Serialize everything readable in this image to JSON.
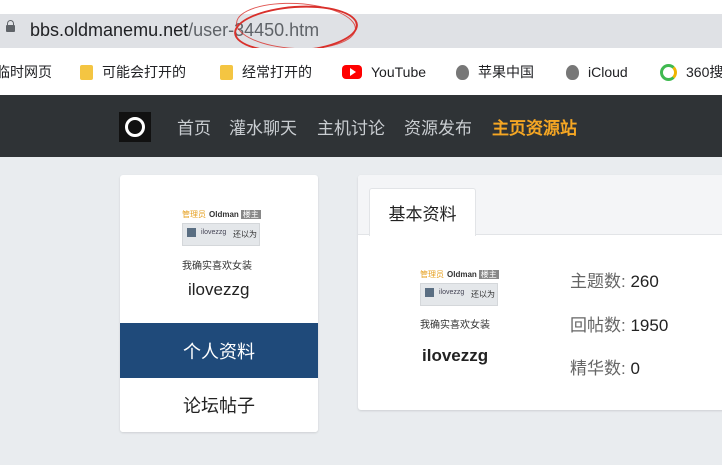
{
  "browser": {
    "url_host": "bbs.oldmanemu.net",
    "url_path": "/user-34450.htm"
  },
  "bookmarks": [
    {
      "label": "临时网页",
      "icon": "page-icon"
    },
    {
      "label": "可能会打开的",
      "icon": "folder-icon"
    },
    {
      "label": "经常打开的",
      "icon": "folder-icon"
    },
    {
      "label": "YouTube",
      "icon": "youtube-icon"
    },
    {
      "label": "苹果中国",
      "icon": "apple-icon"
    },
    {
      "label": "iCloud",
      "icon": "apple-icon"
    },
    {
      "label": "360搜",
      "icon": "360-icon"
    }
  ],
  "nav": {
    "items": [
      "首页",
      "灌水聊天",
      "主机讨论",
      "资源发布",
      "主页资源站"
    ],
    "active_index": 4
  },
  "profile": {
    "badge_role": "管理员",
    "badge_name": "Oldman",
    "badge_tag": "楼主",
    "badge_user": "ilovezzg",
    "badge_extra": "还以为",
    "motto": "我确实喜欢女装",
    "username": "ilovezzg"
  },
  "side_menu": {
    "active": "个人资料",
    "other": "论坛帖子"
  },
  "panel": {
    "tab": "基本资料",
    "stats": [
      {
        "label": "主题数:",
        "value": "260"
      },
      {
        "label": "回帖数:",
        "value": "1950"
      },
      {
        "label": "精华数:",
        "value": "0"
      }
    ]
  },
  "colors": {
    "nav_bg": "#2f3336",
    "nav_active": "#f5a623",
    "menu_active_bg": "#1f4a7a",
    "annotation_red": "#d9302b"
  }
}
